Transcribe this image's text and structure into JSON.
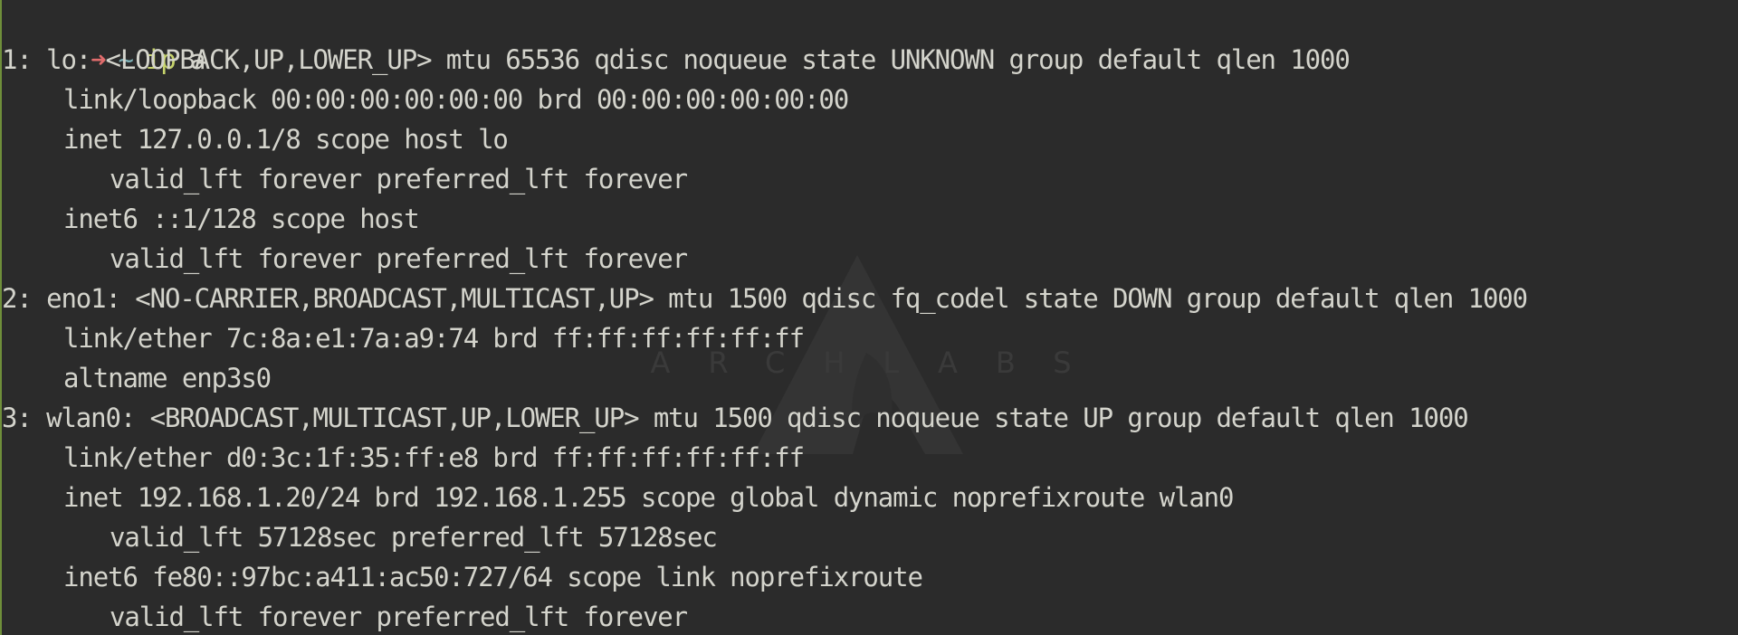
{
  "prompt": {
    "arrow_icon": "right-arrow-icon",
    "arrow_glyph": "➜",
    "cwd": "~",
    "command": "ip",
    "argument": "a"
  },
  "watermark": {
    "text": "ARCHLABS"
  },
  "output": [
    {
      "indent": 0,
      "text": "1: lo: <LOOPBACK,UP,LOWER_UP> mtu 65536 qdisc noqueue state UNKNOWN group default qlen 1000"
    },
    {
      "indent": 1,
      "text": "link/loopback 00:00:00:00:00:00 brd 00:00:00:00:00:00"
    },
    {
      "indent": 1,
      "text": "inet 127.0.0.1/8 scope host lo"
    },
    {
      "indent": 2,
      "text": "valid_lft forever preferred_lft forever"
    },
    {
      "indent": 1,
      "text": "inet6 ::1/128 scope host"
    },
    {
      "indent": 2,
      "text": "valid_lft forever preferred_lft forever"
    },
    {
      "indent": 0,
      "text": "2: eno1: <NO-CARRIER,BROADCAST,MULTICAST,UP> mtu 1500 qdisc fq_codel state DOWN group default qlen 1000"
    },
    {
      "indent": 1,
      "text": "link/ether 7c:8a:e1:7a:a9:74 brd ff:ff:ff:ff:ff:ff"
    },
    {
      "indent": 1,
      "text": "altname enp3s0"
    },
    {
      "indent": 0,
      "text": "3: wlan0: <BROADCAST,MULTICAST,UP,LOWER_UP> mtu 1500 qdisc noqueue state UP group default qlen 1000"
    },
    {
      "indent": 1,
      "text": "link/ether d0:3c:1f:35:ff:e8 brd ff:ff:ff:ff:ff:ff"
    },
    {
      "indent": 1,
      "text": "inet 192.168.1.20/24 brd 192.168.1.255 scope global dynamic noprefixroute wlan0"
    },
    {
      "indent": 2,
      "text": "valid_lft 57128sec preferred_lft 57128sec"
    },
    {
      "indent": 1,
      "text": "inet6 fe80::97bc:a411:ac50:727/64 scope link noprefixroute"
    },
    {
      "indent": 2,
      "text": "valid_lft forever preferred_lft forever"
    }
  ]
}
